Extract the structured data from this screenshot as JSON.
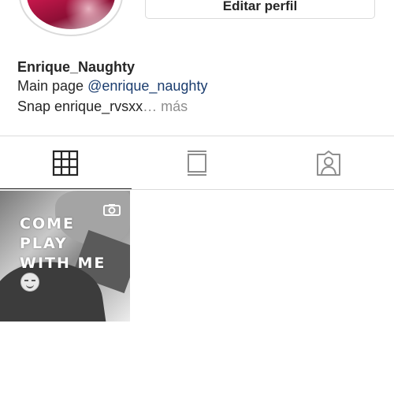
{
  "header": {
    "edit_profile_label": "Editar perfil"
  },
  "profile": {
    "username": "Enrique_Naughty",
    "bio_line1_prefix": "Main page ",
    "bio_mention": "@enrique_naughty",
    "bio_line2_text": "Snap enrique_rvsxx",
    "bio_more": "… más"
  },
  "tabs": [
    {
      "name": "grid",
      "icon": "grid-icon"
    },
    {
      "name": "guides",
      "icon": "book-icon"
    },
    {
      "name": "tagged",
      "icon": "tagged-person-icon"
    }
  ],
  "posts": [
    {
      "overlay_text": [
        "COME",
        "PLAY",
        "WITH ME"
      ]
    }
  ]
}
